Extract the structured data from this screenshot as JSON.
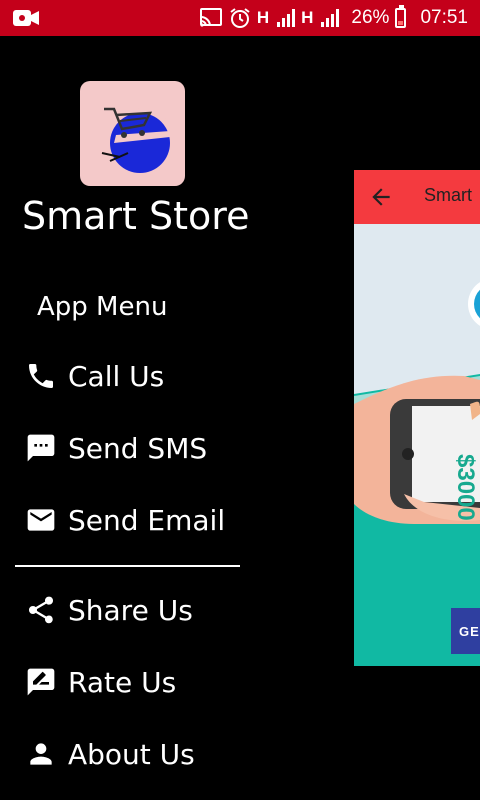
{
  "status_bar": {
    "network1": "H",
    "network2": "H",
    "battery": "26%",
    "time": "07:51"
  },
  "drawer": {
    "app_title": "Smart Store",
    "menu_caption": "App Menu",
    "items": [
      {
        "label": "Call Us",
        "icon": "phone-icon"
      },
      {
        "label": "Send SMS",
        "icon": "sms-icon"
      },
      {
        "label": "Send Email",
        "icon": "email-icon"
      },
      {
        "label": "Share Us",
        "icon": "share-icon"
      },
      {
        "label": "Rate Us",
        "icon": "rate-icon"
      },
      {
        "label": "About Us",
        "icon": "person-icon"
      }
    ]
  },
  "background_app": {
    "toolbar_title": "Smart",
    "phone_amount": "$3000",
    "cta_label": "GE",
    "toolbar_color": "#f43a3f"
  },
  "colors": {
    "status_bar": "#c4001a",
    "drawer_bg": "#000000",
    "logo_bg": "#f4c9c9"
  }
}
